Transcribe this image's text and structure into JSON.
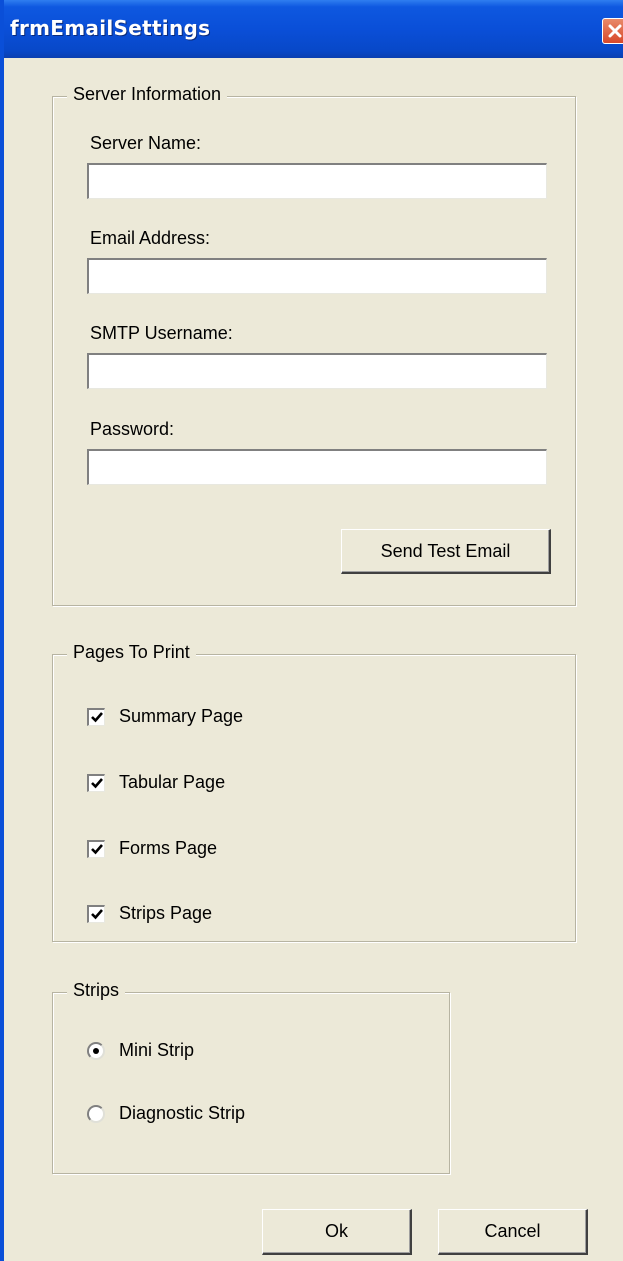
{
  "window": {
    "title": "frmEmailSettings",
    "close_glyph": "✕"
  },
  "server_group": {
    "legend": "Server Information",
    "server_name": {
      "label": "Server Name:",
      "value": "",
      "placeholder": ""
    },
    "email_address": {
      "label": "Email Address:",
      "value": "",
      "placeholder": ""
    },
    "smtp_username": {
      "label": "SMTP Username:",
      "value": "",
      "placeholder": ""
    },
    "password": {
      "label": "Password:",
      "value": "",
      "placeholder": ""
    },
    "send_test_label": "Send Test Email"
  },
  "pages_group": {
    "legend": "Pages To Print",
    "items": [
      {
        "label": "Summary Page",
        "checked": true
      },
      {
        "label": "Tabular Page",
        "checked": true
      },
      {
        "label": "Forms Page",
        "checked": true
      },
      {
        "label": "Strips Page",
        "checked": true
      }
    ]
  },
  "strips_group": {
    "legend": "Strips",
    "options": [
      {
        "label": "Mini Strip",
        "selected": true
      },
      {
        "label": "Diagnostic Strip",
        "selected": false
      }
    ]
  },
  "footer": {
    "ok_label": "Ok",
    "cancel_label": "Cancel"
  },
  "colors": {
    "titlebar": "#0a4fd8",
    "window_bg": "#ece9d8",
    "close_button": "#d8482a"
  },
  "icons": {
    "check_mark": "check-icon",
    "close": "close-icon"
  }
}
